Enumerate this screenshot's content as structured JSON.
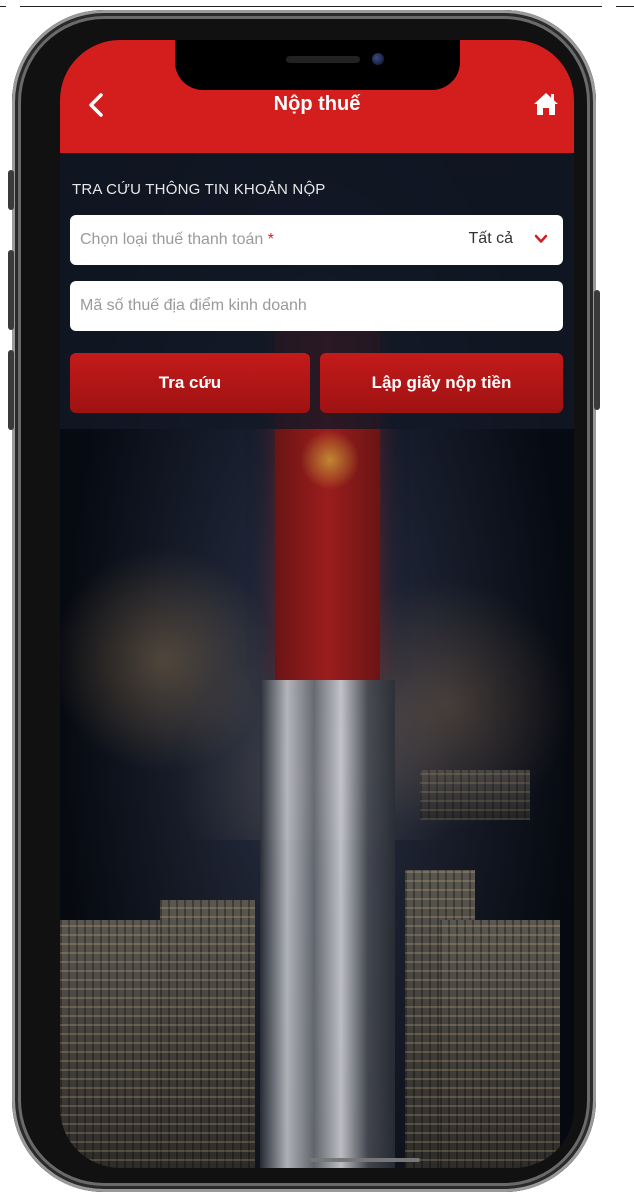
{
  "app_bar": {
    "title": "Nộp thuế",
    "back_icon": "chevron-left-icon",
    "home_icon": "home-icon"
  },
  "lookup": {
    "section_title": "TRA CỨU THÔNG TIN KHOẢN NỘP",
    "tax_type_placeholder": "Chọn loại thuế thanh toán",
    "tax_type_required_mark": "*",
    "tax_type_value": "Tất cả",
    "business_tax_code_placeholder": "Mã số thuế địa điểm kinh doanh",
    "search_button": "Tra cứu",
    "create_payment_button": "Lập giấy nộp tiền"
  },
  "colors": {
    "brand_red": "#d41d1d",
    "button_red": "#b01616"
  }
}
